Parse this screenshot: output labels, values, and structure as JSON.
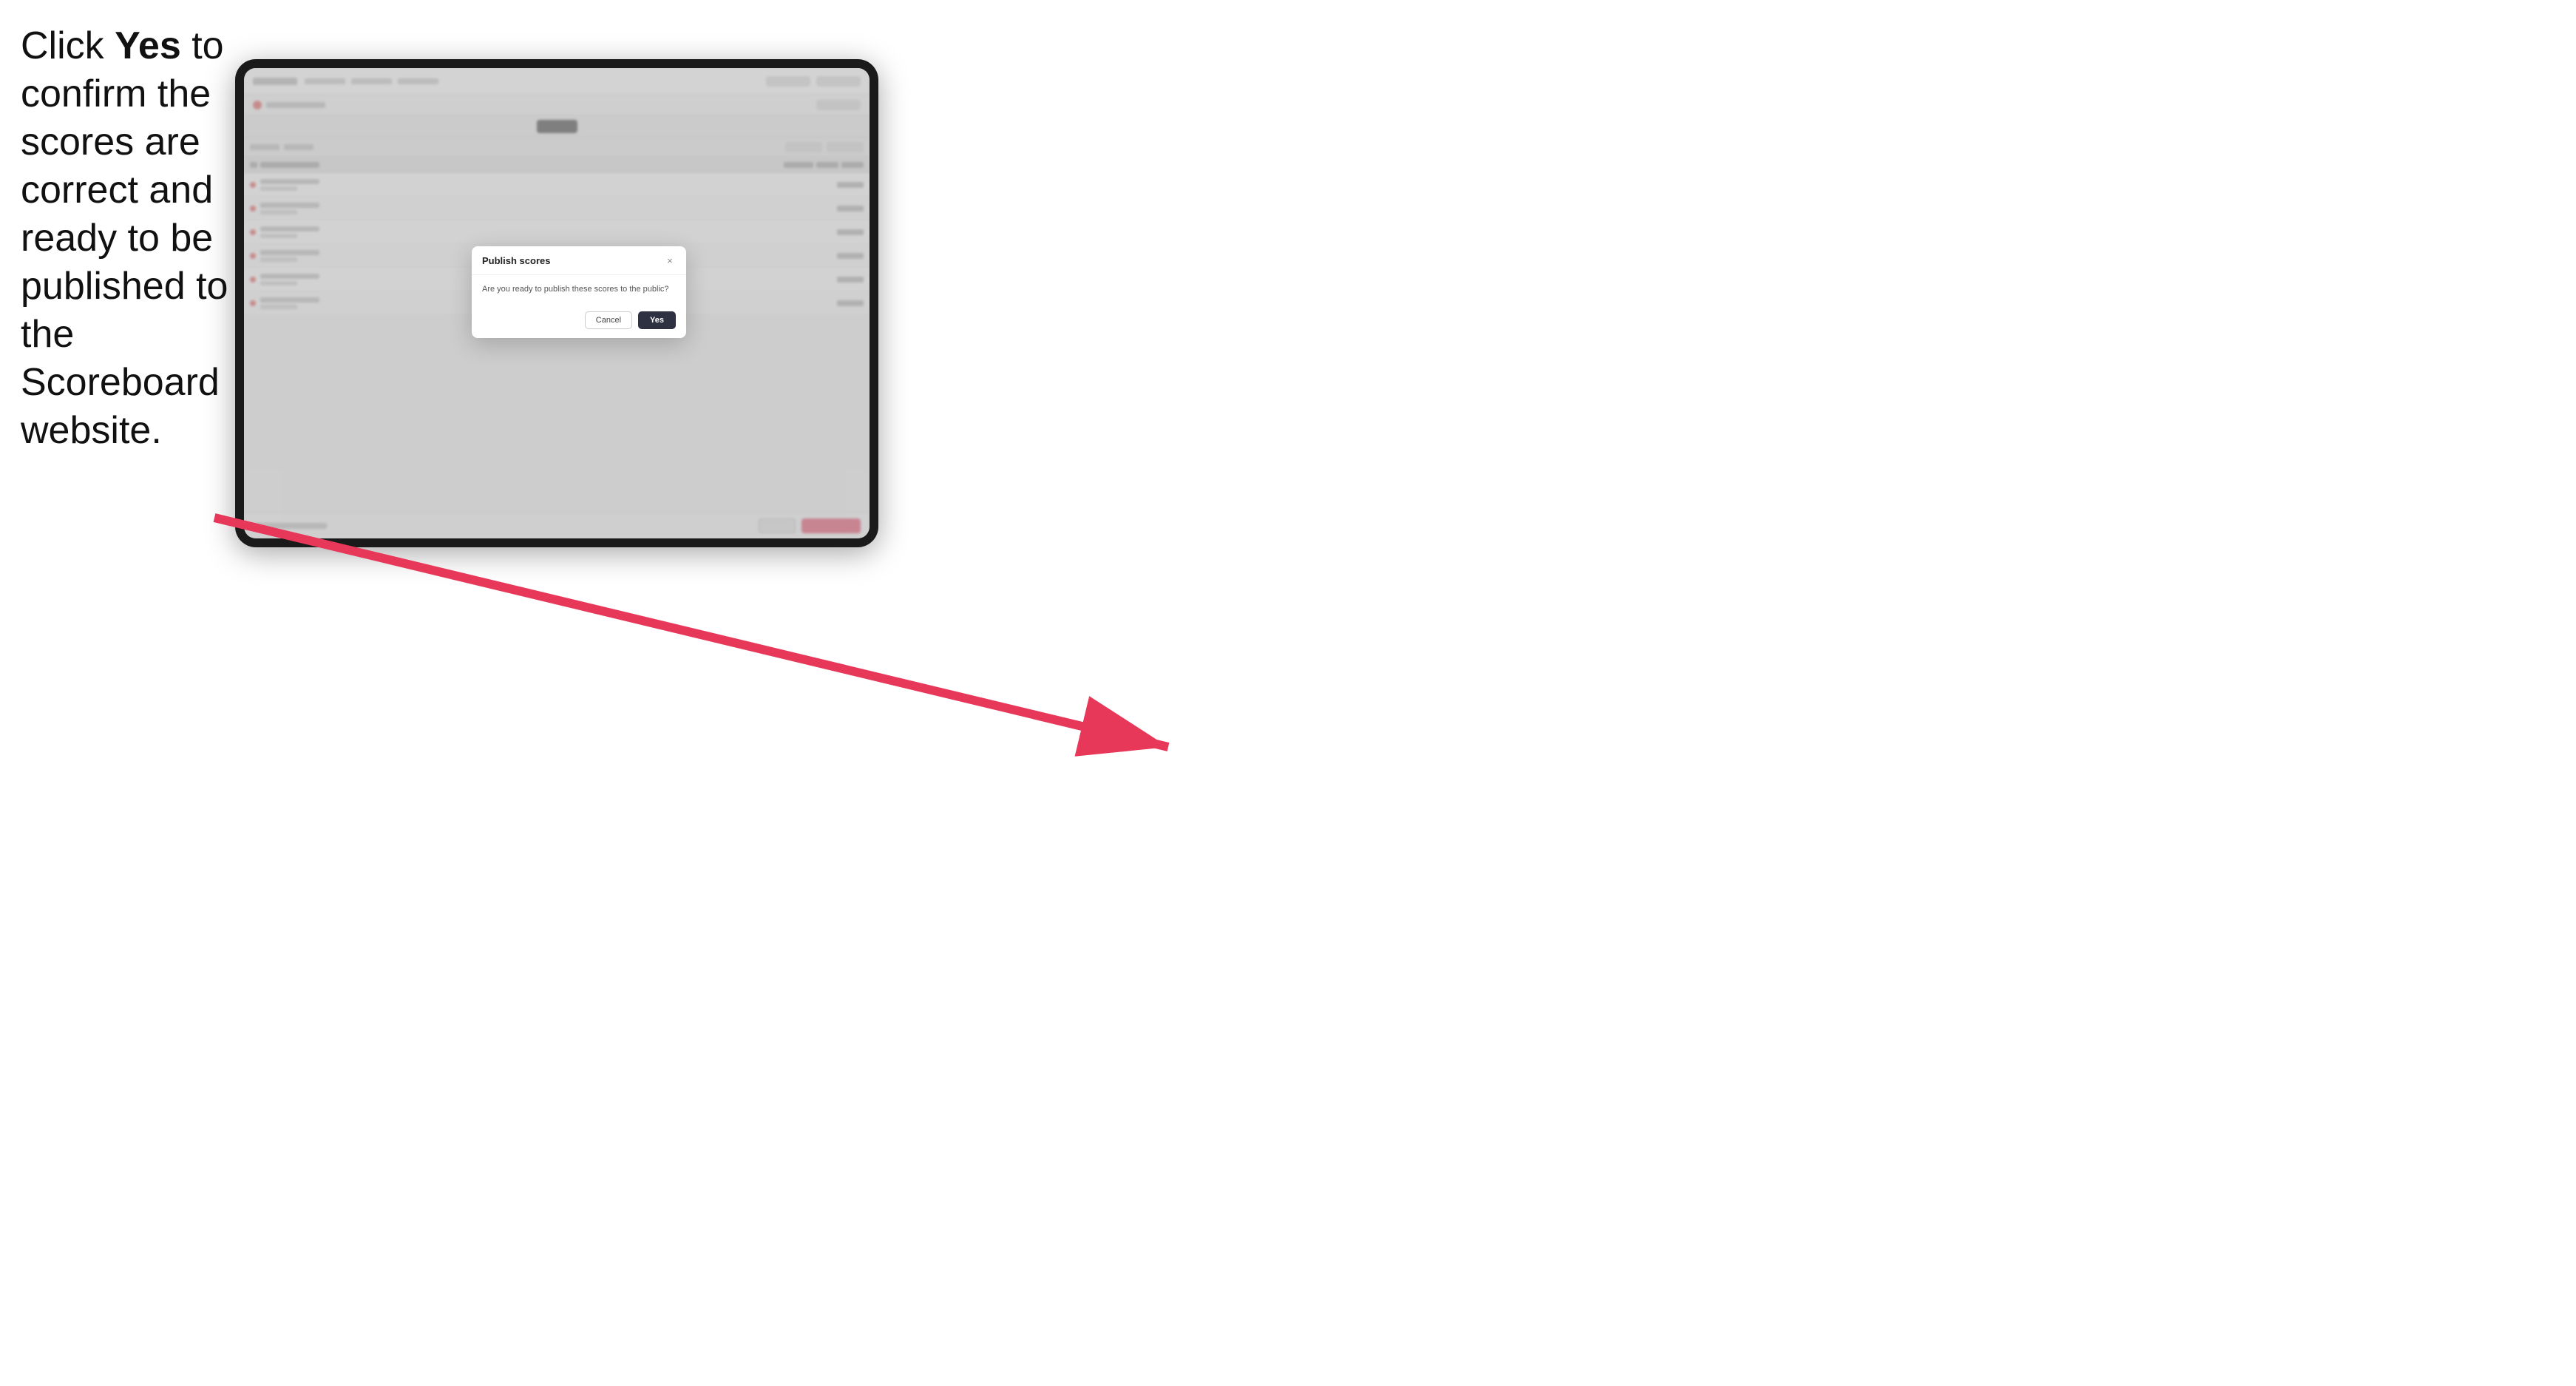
{
  "instruction": {
    "text_html": "Click <strong>Yes</strong> to confirm the scores are correct and ready to be published to the Scoreboard website."
  },
  "modal": {
    "title": "Publish scores",
    "body_text": "Are you ready to publish these scores to the public?",
    "cancel_label": "Cancel",
    "yes_label": "Yes",
    "close_icon": "×"
  },
  "app": {
    "publish_btn_label": "",
    "table_rows": [
      {
        "id": 1
      },
      {
        "id": 2
      },
      {
        "id": 3
      },
      {
        "id": 4
      },
      {
        "id": 5
      },
      {
        "id": 6
      },
      {
        "id": 7
      }
    ]
  }
}
